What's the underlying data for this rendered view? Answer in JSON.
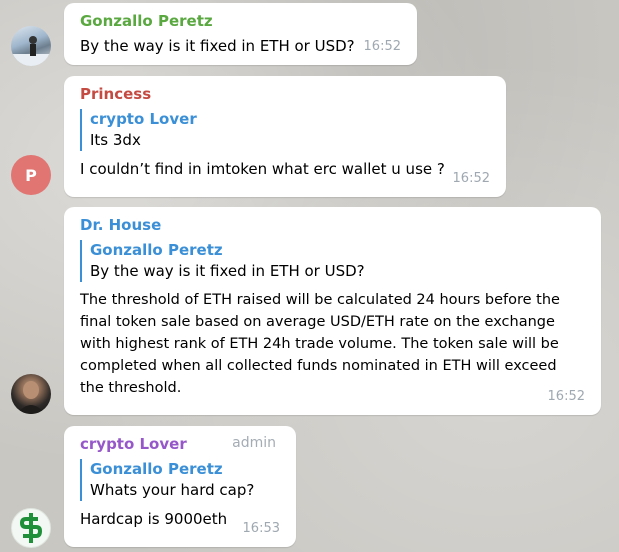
{
  "messages": [
    {
      "sender": "Gonzallo Peretz",
      "sender_color": "#5aa840",
      "text": "By the way is it fixed in ETH or USD?",
      "time": "16:52"
    },
    {
      "sender": "Princess",
      "sender_color": "#c44b42",
      "avatar_letter": "P",
      "reply": {
        "name": "crypto Lover",
        "text": "Its 3dx"
      },
      "text": "I couldn’t find in imtoken what erc wallet u use ?",
      "time": "16:52"
    },
    {
      "sender": "Dr. House",
      "sender_color": "#3a8fd6",
      "reply": {
        "name": "Gonzallo Peretz",
        "text": "By the way is it fixed in ETH or USD?"
      },
      "text": "The threshold of ETH raised will be calculated 24 hours before the final token sale based on average USD/ETH rate on the exchange with highest rank of ETH 24h trade volume. The token sale will be completed when all collected funds nominated in ETH will exceed the threshold.",
      "time": "16:52"
    },
    {
      "sender": "crypto Lover",
      "sender_color": "#9658c9",
      "badge": "admin",
      "reply": {
        "name": "Gonzallo Peretz",
        "text": "Whats your hard cap?"
      },
      "text": "Hardcap is 9000eth",
      "time": "16:53"
    }
  ]
}
